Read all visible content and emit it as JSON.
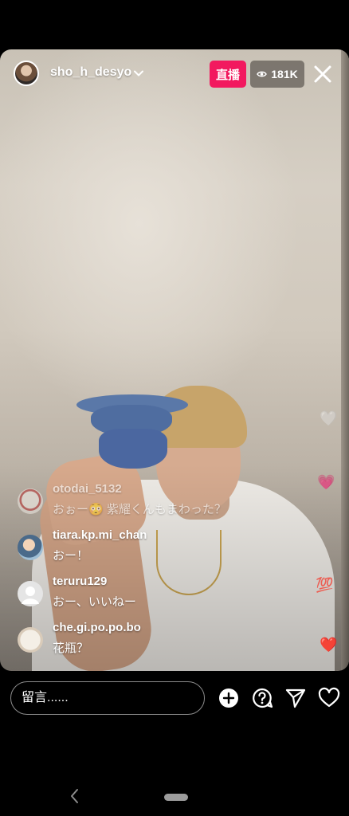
{
  "header": {
    "username": "sho_h_desyo",
    "live_label": "直播",
    "viewer_count": "181K"
  },
  "comments": [
    {
      "user": "otodai_5132",
      "text": "おぉー😳 紫耀くんもまわった？"
    },
    {
      "user": "tiara.kp.mi_chan",
      "text": "おー！"
    },
    {
      "user": "teruru129",
      "text": "おー、いいねー"
    },
    {
      "user": "che.gi.po.po.bo",
      "text": "花瓶？"
    }
  ],
  "reactions": [
    "🤍",
    "💗",
    "💯",
    "❤️"
  ],
  "composer": {
    "placeholder": "留言......"
  },
  "icons": {
    "close": "close-icon",
    "eye": "eye-icon",
    "add": "add-icon",
    "question": "question-icon",
    "send": "send-icon",
    "like": "heart-icon"
  },
  "colors": {
    "live_badge": "#f2195f",
    "background": "#000000"
  }
}
